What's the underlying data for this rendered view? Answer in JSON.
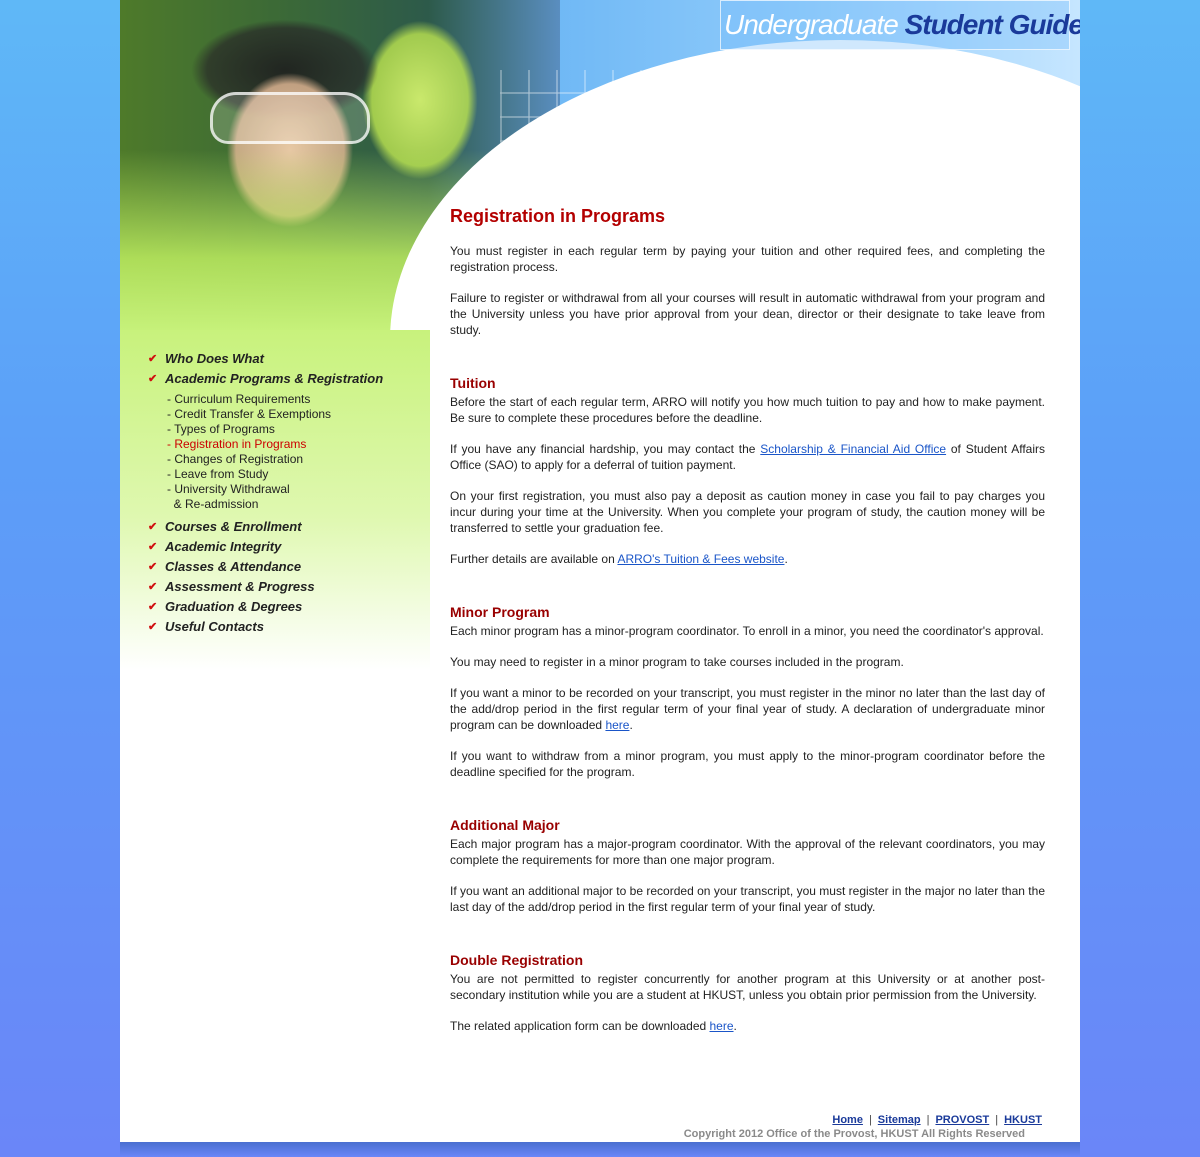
{
  "header": {
    "title_part1": "Undergraduate ",
    "title_part2": "Student Guide"
  },
  "nav": {
    "main_items": [
      {
        "label": "Who Does What"
      },
      {
        "label": "Academic Programs & Registration"
      },
      {
        "label": "Courses & Enrollment"
      },
      {
        "label": "Academic Integrity"
      },
      {
        "label": "Classes & Attendance"
      },
      {
        "label": "Assessment & Progress"
      },
      {
        "label": "Graduation & Degrees"
      },
      {
        "label": "Useful Contacts"
      }
    ],
    "sub_items": [
      {
        "label": "- Curriculum Requirements"
      },
      {
        "label": "- Credit Transfer & Exemptions"
      },
      {
        "label": "- Types of Programs"
      },
      {
        "label": "- Registration in Programs"
      },
      {
        "label": "- Changes of Registration"
      },
      {
        "label": "- Leave from Study"
      },
      {
        "label": "- University Withdrawal\n  & Re-admission"
      }
    ]
  },
  "content": {
    "title": "Registration in Programs",
    "intro_p1": "You must register in each regular term by paying your tuition and other required fees, and completing the registration process.",
    "intro_p2": "Failure to register or withdrawal from all your courses will result in automatic withdrawal from your program and the University unless you have prior approval from your dean, director or their designate to take leave from study.",
    "tuition": {
      "heading": "Tuition",
      "p1": "Before the start of each regular term, ARRO will notify you how much tuition to pay and how to make payment. Be sure to complete these procedures before the deadline.",
      "p2_pre": "If you have any financial hardship, you may contact the ",
      "p2_link": "Scholarship & Financial Aid Office",
      "p2_post": " of Student Affairs Office (SAO) to apply for a deferral of tuition payment.",
      "p3": "On your first registration, you must also pay a deposit as caution money in case you fail to pay charges you incur during your time at the University. When you complete your program of study, the caution money will be transferred to settle your graduation fee.",
      "p4_pre": "Further details are available on ",
      "p4_link": "ARRO's Tuition & Fees website",
      "p4_post": "."
    },
    "minor": {
      "heading": "Minor Program",
      "p1": "Each minor program has a minor-program coordinator. To enroll in a minor, you need the coordinator's approval.",
      "p2": "You may need to register in a minor program to take courses included in the program.",
      "p3_pre": "If you want a minor to be recorded on your transcript, you must register in the minor no later than the last day of the add/drop period in the first regular term of your final year of study. A declaration of undergraduate minor program can be downloaded ",
      "p3_link": "here",
      "p3_post": ".",
      "p4": "If you want to withdraw from a minor program, you must apply to the minor-program coordinator before the deadline specified for the program."
    },
    "major": {
      "heading": "Additional Major",
      "p1": "Each major program has a major-program coordinator. With the approval of the relevant coordinators, you may complete the requirements for more than one major program.",
      "p2": "If you want an additional major to be recorded on your transcript, you must register in the major no later than the last day of the add/drop period in the first regular term of your final year of study."
    },
    "double": {
      "heading": "Double Registration",
      "p1": "You are not permitted to register concurrently for another program at this University or at another post-secondary institution while you are a student at HKUST, unless you obtain prior permission from the University.",
      "p2_pre": "The related application form can be downloaded ",
      "p2_link": "here",
      "p2_post": "."
    }
  },
  "footer": {
    "links": [
      "Home",
      "Sitemap",
      "PROVOST",
      "HKUST"
    ],
    "separator": "|",
    "copyright": "Copyright 2012 Office of the Provost, HKUST   All Rights Reserved"
  },
  "colors": {
    "heading_red": "#b30000",
    "link_blue": "#1a55c8",
    "nav_active": "#cc0000"
  }
}
